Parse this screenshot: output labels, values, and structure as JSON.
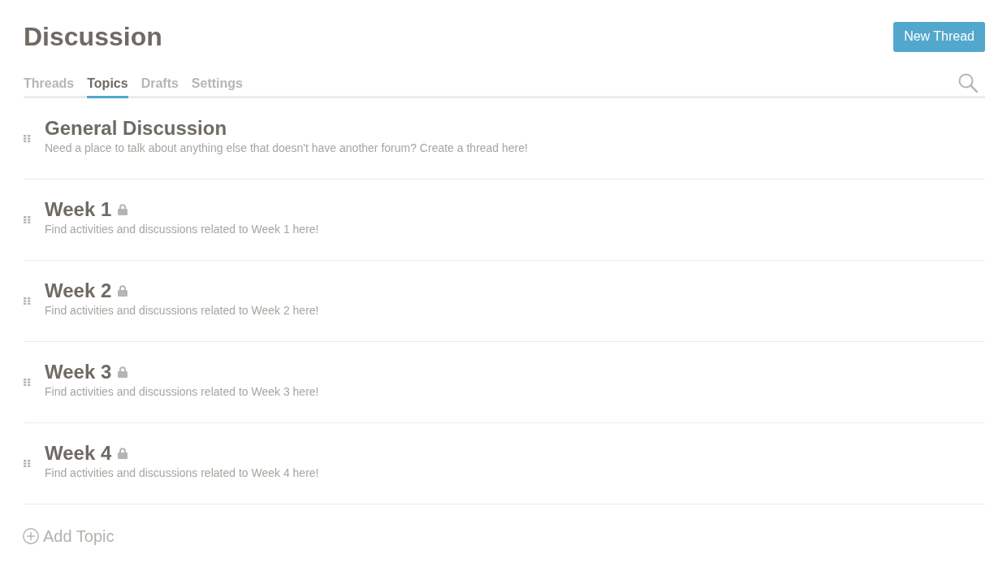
{
  "header": {
    "title": "Discussion",
    "new_thread_button": "New Thread"
  },
  "tabs": [
    {
      "label": "Threads",
      "selected": false
    },
    {
      "label": "Topics",
      "selected": true
    },
    {
      "label": "Drafts",
      "selected": false
    },
    {
      "label": "Settings",
      "selected": false
    }
  ],
  "topics": [
    {
      "title": "General Discussion",
      "description": "Need a place to talk about anything else that doesn't have another forum? Create a thread here!",
      "locked": false
    },
    {
      "title": "Week 1",
      "description": "Find activities and discussions related to Week 1 here!",
      "locked": true
    },
    {
      "title": "Week 2",
      "description": "Find activities and discussions related to Week 2 here!",
      "locked": true
    },
    {
      "title": "Week 3",
      "description": "Find activities and discussions related to Week 3 here!",
      "locked": true
    },
    {
      "title": "Week 4",
      "description": "Find activities and discussions related to Week 4 here!",
      "locked": true
    }
  ],
  "add_topic": {
    "label": "Add Topic"
  }
}
